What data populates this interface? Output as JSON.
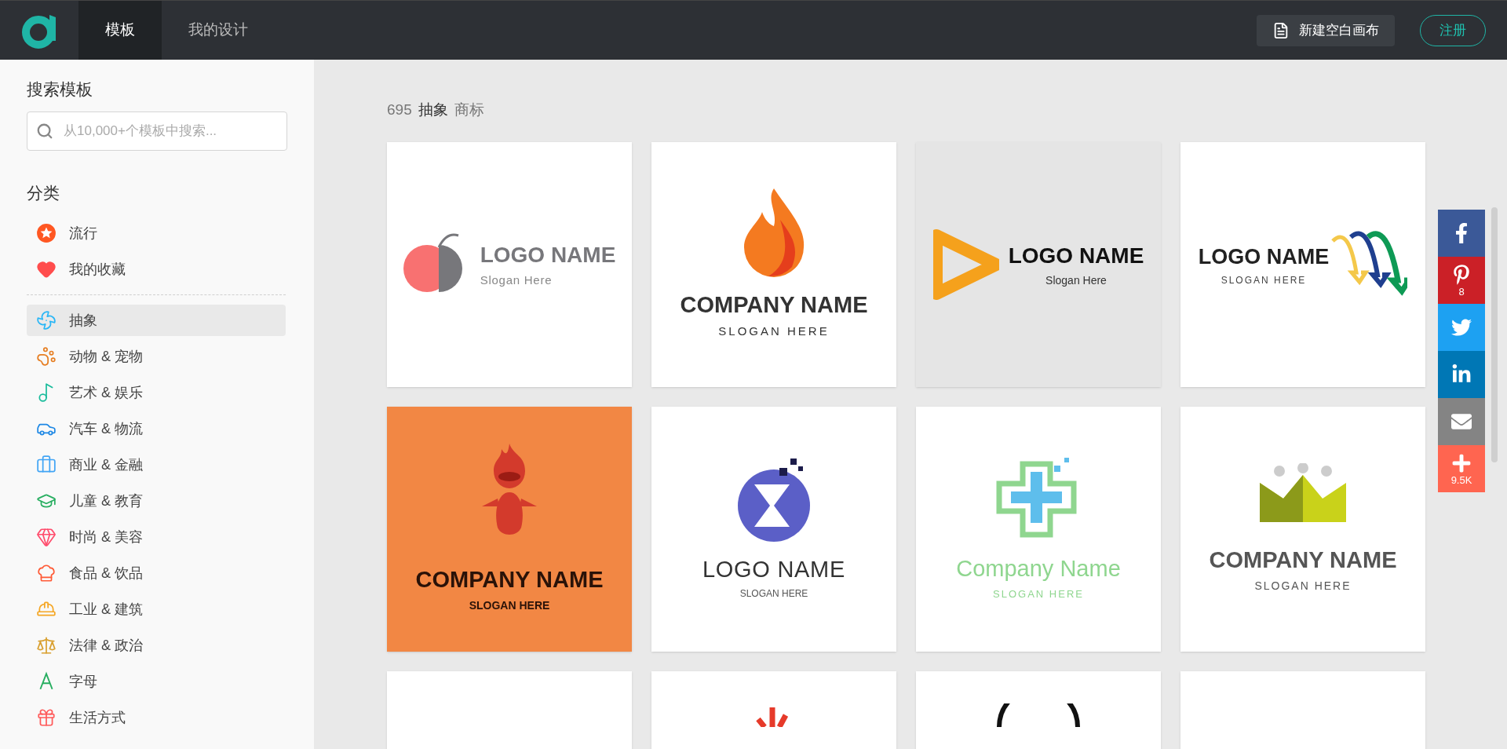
{
  "header": {
    "tabs": [
      {
        "label": "模板",
        "selected": true
      },
      {
        "label": "我的设计",
        "selected": false
      }
    ],
    "new_button": "新建空白画布",
    "register_button": "注册"
  },
  "sidebar": {
    "search_title": "搜索模板",
    "search": {
      "placeholder": "从10,000+个模板中搜索..."
    },
    "category_title": "分类",
    "top_items": [
      {
        "kind": "popular",
        "label": "流行",
        "selected": false
      },
      {
        "kind": "favorites",
        "label": "我的收藏",
        "selected": false
      }
    ],
    "items": [
      {
        "kind": "abstract",
        "label": "抽象",
        "selected": true
      },
      {
        "kind": "animals",
        "label": "动物 & 宠物",
        "selected": false
      },
      {
        "kind": "arts",
        "label": "艺术 & 娱乐",
        "selected": false
      },
      {
        "kind": "cars",
        "label": "汽车 & 物流",
        "selected": false
      },
      {
        "kind": "business",
        "label": "商业 & 金融",
        "selected": false
      },
      {
        "kind": "education",
        "label": "儿童 & 教育",
        "selected": false
      },
      {
        "kind": "fashion",
        "label": "时尚 & 美容",
        "selected": false
      },
      {
        "kind": "food",
        "label": "食品 & 饮品",
        "selected": false
      },
      {
        "kind": "industry",
        "label": "工业 & 建筑",
        "selected": false
      },
      {
        "kind": "law",
        "label": "法律 & 政治",
        "selected": false
      },
      {
        "kind": "letters",
        "label": "字母",
        "selected": false
      },
      {
        "kind": "lifestyle",
        "label": "生活方式",
        "selected": false
      }
    ]
  },
  "breadcrumb": {
    "count": "695",
    "category": "抽象",
    "type": "商标"
  },
  "templates": [
    {
      "kind": "brain",
      "title": "LOGO NAME",
      "subtitle": "Slogan Here"
    },
    {
      "kind": "flame",
      "title": "COMPANY NAME",
      "subtitle": "SLOGAN HERE"
    },
    {
      "kind": "play",
      "title": "LOGO NAME",
      "subtitle": "Slogan Here"
    },
    {
      "kind": "arrows",
      "title": "LOGO NAME",
      "subtitle": "SLOGAN HERE"
    },
    {
      "kind": "mascot",
      "title": "COMPANY NAME",
      "subtitle": "SLOGAN HERE"
    },
    {
      "kind": "sigma",
      "title": "LOGO NAME",
      "subtitle": "SLOGAN HERE"
    },
    {
      "kind": "cross",
      "title": "Company Name",
      "subtitle": "SLOGAN HERE"
    },
    {
      "kind": "crown",
      "title": "COMPANY NAME",
      "subtitle": "SLOGAN HERE"
    },
    {
      "kind": "blank"
    },
    {
      "kind": "burst"
    },
    {
      "kind": "ring"
    },
    {
      "kind": "blank"
    }
  ],
  "share": [
    {
      "kind": "facebook"
    },
    {
      "kind": "pinterest",
      "count": "8"
    },
    {
      "kind": "twitter"
    },
    {
      "kind": "linkedin"
    },
    {
      "kind": "email"
    },
    {
      "kind": "more",
      "count": "9.5K"
    }
  ]
}
